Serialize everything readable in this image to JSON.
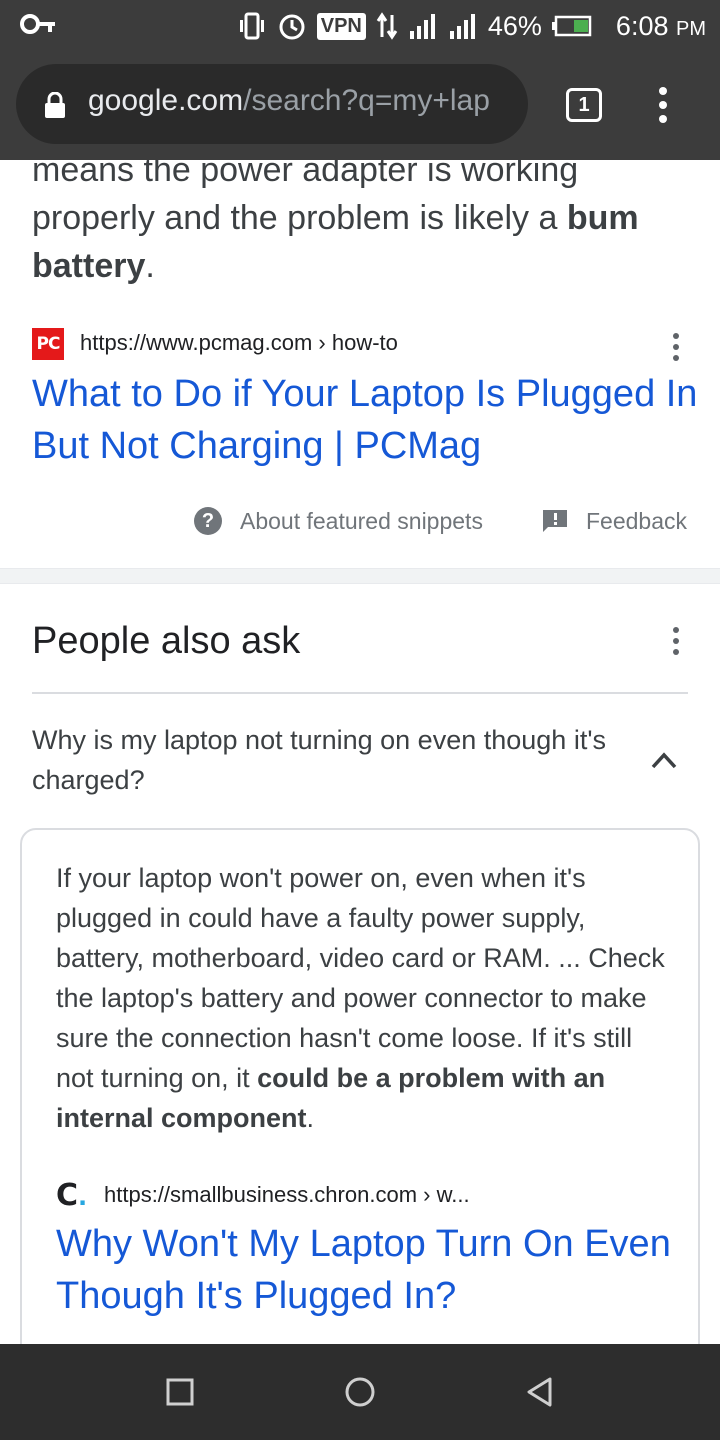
{
  "status_bar": {
    "key_icon": "key-icon",
    "vpn_label": "VPN",
    "battery_percent": "46%",
    "time": "6:08",
    "time_suffix": "PM",
    "icons": [
      "vibrate-icon",
      "alarm-icon",
      "data-arrows-icon",
      "signal-icon",
      "signal-icon",
      "battery-icon"
    ]
  },
  "address_bar": {
    "url_host": "google.com",
    "url_path": "/search?q=my+lap",
    "tab_count": "1"
  },
  "featured_snippet": {
    "text_before": "means the power adapter is working properly and the problem is likely a ",
    "text_bold": "bum battery",
    "text_after": ".",
    "source_logo": "PC",
    "source_url": "https://www.pcmag.com › how-to",
    "title": "What to Do if Your Laptop Is Plugged In But Not Charging | PCMag",
    "about_label": "About featured snippets",
    "feedback_label": "Feedback"
  },
  "people_also_ask": {
    "heading": "People also ask",
    "question": "Why is my laptop not turning on even though it's charged?",
    "answer_before": "If your laptop won't power on, even when it's plugged in could have a faulty power supply, battery, motherboard, video card or RAM. ... Check the laptop's battery and power connector to make sure the connection hasn't come loose. If it's still not turning on, it ",
    "answer_bold": "could be a problem with an internal component",
    "answer_after": ".",
    "source_logo": "C",
    "source_url": "https://smallbusiness.chron.com › w...",
    "link_title": "Why Won't My Laptop Turn On Even Though It's Plugged In?"
  },
  "nav": {
    "recents": "recents-square-icon",
    "home": "home-circle-icon",
    "back": "back-triangle-icon"
  },
  "colors": {
    "chrome_bg": "#3c3c3c",
    "link_blue": "#1558d6",
    "text_gray": "#3c4043",
    "pc_red": "#e4191a"
  }
}
